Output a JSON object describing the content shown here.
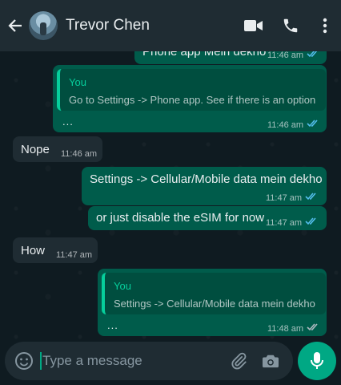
{
  "header": {
    "contact_name": "Trevor Chen"
  },
  "messages": [
    {
      "text": "Phone app Mein dekho",
      "time": "11:46 am"
    },
    {
      "quote_name": "You",
      "quote_text": "Go to Settings -> Phone app. See if there is an option",
      "text": "...",
      "time": "11:46 am"
    },
    {
      "text": "Nope",
      "time": "11:46 am"
    },
    {
      "text": "Settings -> Cellular/Mobile data mein dekho",
      "time": "11:47 am"
    },
    {
      "text": "or just disable the eSIM for now",
      "time": "11:47 am"
    },
    {
      "text": "How",
      "time": "11:47 am"
    },
    {
      "quote_name": "You",
      "quote_text": "Settings -> Cellular/Mobile data mein dekho",
      "text": "...",
      "time": "11:48 am"
    }
  ],
  "composer": {
    "placeholder": "Type a message"
  },
  "colors": {
    "accent": "#00a884",
    "outgoing_bubble": "#005c4b",
    "incoming_bubble": "#1f2c33",
    "read_ticks": "#53bdeb"
  }
}
